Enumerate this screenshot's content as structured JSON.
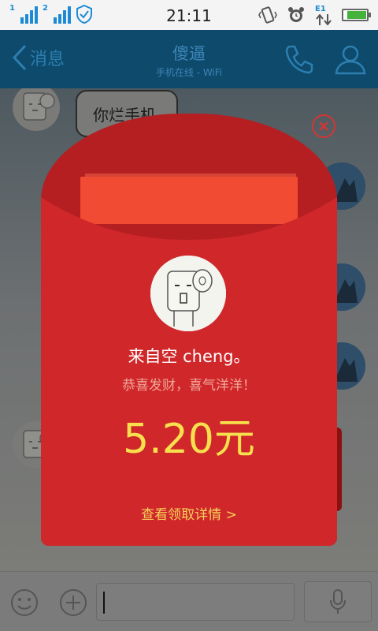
{
  "status_bar": {
    "time": "21:11",
    "sim1_label": "1",
    "sim2_label": "2",
    "network_label": "E1",
    "battery_level": 0.8,
    "icons": [
      "signal-icon",
      "signal-icon",
      "shield-icon",
      "vibrate-icon",
      "alarm-icon",
      "data-arrows-icon",
      "battery-icon"
    ]
  },
  "header": {
    "back_label": "消息",
    "contact_name": "傻逼",
    "contact_status": "手机在线 - WiFi"
  },
  "chat": {
    "messages": [
      {
        "side": "left",
        "text": "你烂手机"
      }
    ]
  },
  "red_packet": {
    "sender": "来自空 cheng。",
    "greeting": "恭喜发财，喜气洋洋！",
    "amount": "5.20元",
    "details_link": "查看领取详情  >"
  },
  "colors": {
    "envelope": "#d0272a",
    "envelope_flap": "#b51f22",
    "amount": "#f7e04d",
    "link": "#f5d25a",
    "greeting": "#f0a79a",
    "titlebar": "#0e4a6c"
  }
}
